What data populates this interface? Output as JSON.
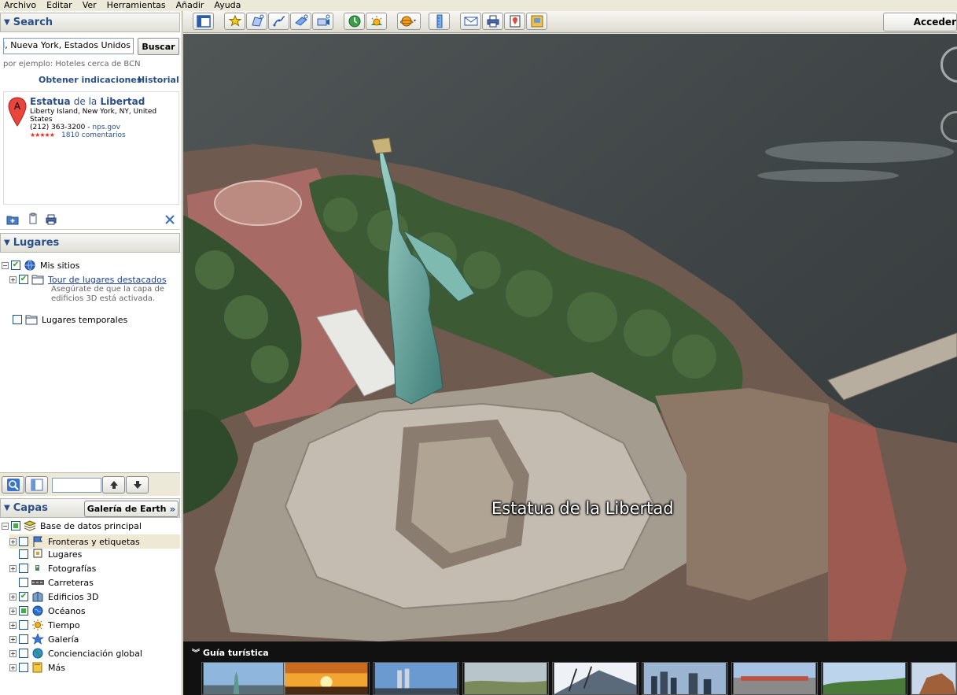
{
  "menu": [
    {
      "label": "Archivo"
    },
    {
      "label": "Editar"
    },
    {
      "label": "Ver"
    },
    {
      "label": "Herramientas"
    },
    {
      "label": "Añadir"
    },
    {
      "label": "Ayuda"
    }
  ],
  "search": {
    "header": "Search",
    "query": "rtad, Nueva York, Estados Unidos",
    "button": "Buscar",
    "hint": "por ejemplo: Hoteles cerca de BCN",
    "directions_link": "Obtener indicaciones",
    "history_link": "Historial",
    "result": {
      "marker_letter": "A",
      "title_a": "Estatua",
      "title_b": "de la",
      "title_c": "Libertad",
      "address": "Liberty Island, New York, NY, United States",
      "phone": "(212) 363-3200",
      "separator": " - ",
      "site": "nps.gov",
      "stars": "★★★★★",
      "rating": 4.5,
      "reviews": "1810 comentarios"
    }
  },
  "places": {
    "header": "Lugares",
    "items": {
      "my_places": "Mis sitios",
      "tour_link": "Tour de lugares destacados",
      "tour_note": "Asegúrate de que la capa de edificios 3D está activada.",
      "temp_places": "Lugares temporales"
    }
  },
  "layers": {
    "header": "Capas",
    "gallery_button": "Galería de Earth",
    "items": [
      {
        "label": "Base de datos principal",
        "checked": "partial"
      },
      {
        "label": "Fronteras y etiquetas",
        "checked": false
      },
      {
        "label": "Lugares",
        "checked": false
      },
      {
        "label": "Fotografías",
        "checked": false
      },
      {
        "label": "Carreteras",
        "checked": false
      },
      {
        "label": "Edificios 3D",
        "checked": true
      },
      {
        "label": "Océanos",
        "checked": "partial"
      },
      {
        "label": "Tiempo",
        "checked": false
      },
      {
        "label": "Galería",
        "checked": false
      },
      {
        "label": "Concienciación global",
        "checked": false
      },
      {
        "label": "Más",
        "checked": false
      }
    ]
  },
  "toolbar": {
    "signin": "Acceder"
  },
  "map": {
    "label": "Estatua de la Libertad"
  },
  "tour": {
    "title": "Guía turística"
  },
  "colors": {
    "link": "#2a4f87",
    "chrome": "#ece9d8",
    "checked": "#21a121"
  }
}
